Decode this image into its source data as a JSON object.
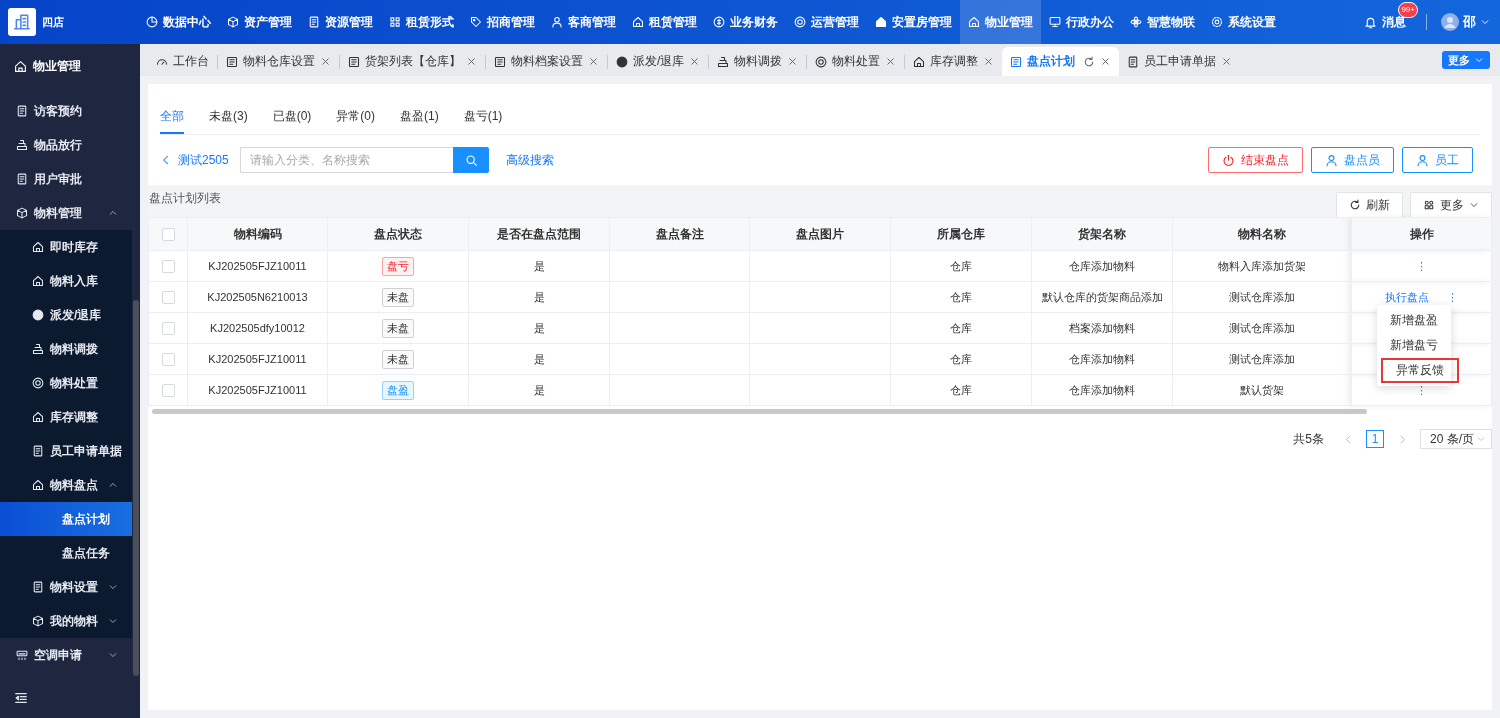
{
  "header": {
    "brand": "四店",
    "nav": [
      {
        "label": "数据中心",
        "selected": false
      },
      {
        "label": "资产管理",
        "selected": false
      },
      {
        "label": "资源管理",
        "selected": false
      },
      {
        "label": "租赁形式",
        "selected": false
      },
      {
        "label": "招商管理",
        "selected": false
      },
      {
        "label": "客商管理",
        "selected": false
      },
      {
        "label": "租赁管理",
        "selected": false
      },
      {
        "label": "业务财务",
        "selected": false
      },
      {
        "label": "运营管理",
        "selected": false
      },
      {
        "label": "安置房管理",
        "selected": false
      },
      {
        "label": "物业管理",
        "selected": true
      },
      {
        "label": "行政办公",
        "selected": false
      },
      {
        "label": "智慧物联",
        "selected": false
      },
      {
        "label": "系统设置",
        "selected": false
      }
    ],
    "messages": {
      "label": "消息",
      "badge": "99+"
    },
    "user": {
      "name": "邵"
    }
  },
  "sidebar": {
    "title": "物业管理",
    "items": [
      {
        "label": "访客预约",
        "selected": false
      },
      {
        "label": "物品放行",
        "selected": false
      },
      {
        "label": "用户审批",
        "selected": false
      },
      {
        "label": "物料管理",
        "selected": false,
        "expanded": true,
        "children": [
          {
            "label": "即时库存",
            "selected": false
          },
          {
            "label": "物料入库",
            "selected": false
          },
          {
            "label": "派发/退库",
            "selected": false
          },
          {
            "label": "物料调拨",
            "selected": false
          },
          {
            "label": "物料处置",
            "selected": false
          },
          {
            "label": "库存调整",
            "selected": false
          },
          {
            "label": "员工申请单据",
            "selected": false
          },
          {
            "label": "物料盘点",
            "selected": false,
            "expanded": true,
            "children": [
              {
                "label": "盘点计划",
                "selected": true
              },
              {
                "label": "盘点任务",
                "selected": false
              }
            ]
          },
          {
            "label": "物料设置",
            "selected": false,
            "expanded": false
          },
          {
            "label": "我的物料",
            "selected": false,
            "expanded": false
          }
        ]
      },
      {
        "label": "空调申请",
        "selected": false,
        "expanded": false
      }
    ]
  },
  "tabs": {
    "items": [
      {
        "label": "工作台",
        "selected": false,
        "closable": false
      },
      {
        "label": "物料仓库设置",
        "selected": false,
        "closable": true
      },
      {
        "label": "货架列表【仓库】",
        "selected": false,
        "closable": true
      },
      {
        "label": "物料档案设置",
        "selected": false,
        "closable": true
      },
      {
        "label": "派发/退库",
        "selected": false,
        "closable": true
      },
      {
        "label": "物料调拨",
        "selected": false,
        "closable": true
      },
      {
        "label": "物料处置",
        "selected": false,
        "closable": true
      },
      {
        "label": "库存调整",
        "selected": false,
        "closable": true
      },
      {
        "label": "盘点计划",
        "selected": true,
        "closable": true
      },
      {
        "label": "员工申请单据",
        "selected": false,
        "closable": true
      }
    ],
    "more": "更多"
  },
  "page": {
    "filters": [
      {
        "label": "全部",
        "selected": true
      },
      {
        "label": "未盘(3)",
        "selected": false
      },
      {
        "label": "已盘(0)",
        "selected": false
      },
      {
        "label": "异常(0)",
        "selected": false
      },
      {
        "label": "盘盈(1)",
        "selected": false
      },
      {
        "label": "盘亏(1)",
        "selected": false
      }
    ],
    "back": "测试2505",
    "search": {
      "placeholder": "请输入分类、名称搜索"
    },
    "advanced_search": "高级搜索",
    "actions": [
      {
        "label": "结束盘点",
        "kind": "danger"
      },
      {
        "label": "盘点员",
        "kind": "person"
      },
      {
        "label": "员工",
        "kind": "person"
      }
    ],
    "table": {
      "title": "盘点计划列表",
      "tools": [
        {
          "label": "刷新",
          "kind": "refresh"
        },
        {
          "label": "更多",
          "kind": "more"
        }
      ],
      "all_checked": false,
      "columns": [
        "物料编码",
        "盘点状态",
        "是否在盘点范围",
        "盘点备注",
        "盘点图片",
        "所属仓库",
        "货架名称",
        "物料名称",
        "操作"
      ],
      "rows": [
        {
          "checked": false,
          "code": "KJ202505FJZ10011",
          "status": {
            "label": "盘亏",
            "kind": "loss"
          },
          "in_scope": "是",
          "warehouse": "仓库",
          "shelf": "仓库添加物料",
          "material": "物料入库添加货架",
          "more": "⋮"
        },
        {
          "checked": false,
          "code": "KJ202505N6210013",
          "status": {
            "label": "未盘",
            "kind": "pending"
          },
          "in_scope": "是",
          "warehouse": "仓库",
          "shelf": "默认仓库的货架商品添加",
          "material": "测试仓库添加",
          "actions": [
            "执行盘点"
          ],
          "more": "⋮"
        },
        {
          "checked": false,
          "code": "KJ202505dfy10012",
          "status": {
            "label": "未盘",
            "kind": "pending"
          },
          "in_scope": "是",
          "warehouse": "仓库",
          "shelf": "档案添加物料",
          "material": "测试仓库添加"
        },
        {
          "checked": false,
          "code": "KJ202505FJZ10011",
          "status": {
            "label": "未盘",
            "kind": "pending"
          },
          "in_scope": "是",
          "warehouse": "仓库",
          "shelf": "仓库添加物料",
          "material": "测试仓库添加"
        },
        {
          "checked": false,
          "code": "KJ202505FJZ10011",
          "status": {
            "label": "盘盈",
            "kind": "gain"
          },
          "in_scope": "是",
          "warehouse": "仓库",
          "shelf": "仓库添加物料",
          "material": "默认货架",
          "more": "⋮"
        }
      ]
    },
    "row_menu": {
      "items": [
        {
          "label": "新增盘盈",
          "highlighted": false
        },
        {
          "label": "新增盘亏",
          "highlighted": false
        },
        {
          "label": "异常反馈",
          "highlighted": true
        }
      ]
    },
    "pagination": {
      "total": "共5条",
      "pages": [
        {
          "label": "1",
          "selected": true
        }
      ],
      "page_size": "20 条/页"
    }
  }
}
